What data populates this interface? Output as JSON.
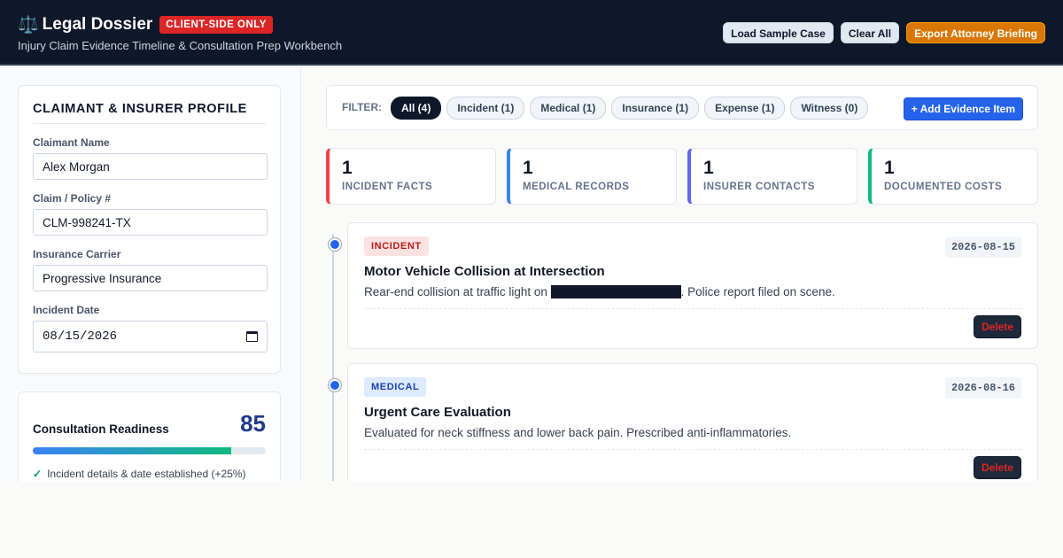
{
  "header": {
    "icon": "scales-icon",
    "title": "Legal Dossier",
    "badge": "CLIENT-SIDE ONLY",
    "subtitle": "Injury Claim Evidence Timeline & Consultation Prep Workbench",
    "actions": {
      "load_sample": "Load Sample Case",
      "clear_all": "Clear All",
      "export": "Export Attorney Briefing"
    }
  },
  "profile": {
    "heading": "CLAIMANT & INSURER PROFILE",
    "fields": {
      "claimant_label": "Claimant Name",
      "claimant_value": "Alex Morgan",
      "claim_label": "Claim / Policy #",
      "claim_value": "CLM-998241-TX",
      "carrier_label": "Insurance Carrier",
      "carrier_value": "Progressive Insurance",
      "date_label": "Incident Date",
      "date_value": "08/15/2026"
    }
  },
  "readiness": {
    "label": "Consultation Readiness",
    "score": "85",
    "percent": 85,
    "checks": [
      "Incident details & date established (+25%)"
    ]
  },
  "filters": {
    "label": "FILTER:",
    "chips": [
      "All (4)",
      "Incident (1)",
      "Medical (1)",
      "Insurance (1)",
      "Expense (1)",
      "Witness (0)"
    ],
    "active_index": 0,
    "add_button": "+ Add Evidence Item"
  },
  "stats": [
    {
      "value": "1",
      "label": "INCIDENT FACTS",
      "color": "#ef4444"
    },
    {
      "value": "1",
      "label": "MEDICAL RECORDS",
      "color": "#3b82f6"
    },
    {
      "value": "1",
      "label": "INSURER CONTACTS",
      "color": "#6366f1"
    },
    {
      "value": "1",
      "label": "DOCUMENTED COSTS",
      "color": "#10b981"
    }
  ],
  "events": [
    {
      "tag": "INCIDENT",
      "tag_bg": "#fee2e2",
      "tag_color": "#b91c1c",
      "date": "2026-08-15",
      "title": "Motor Vehicle Collision at Intersection",
      "desc_before": "Rear-end collision at traffic light on ",
      "desc_after": ". Police report filed on scene.",
      "delete": "Delete"
    },
    {
      "tag": "MEDICAL",
      "tag_bg": "#dbeafe",
      "tag_color": "#1e40af",
      "date": "2026-08-16",
      "title": "Urgent Care Evaluation",
      "desc_before": "Evaluated for neck stiffness and lower back pain. Prescribed anti-inflammatories.",
      "desc_after": "",
      "delete": "Delete"
    }
  ]
}
